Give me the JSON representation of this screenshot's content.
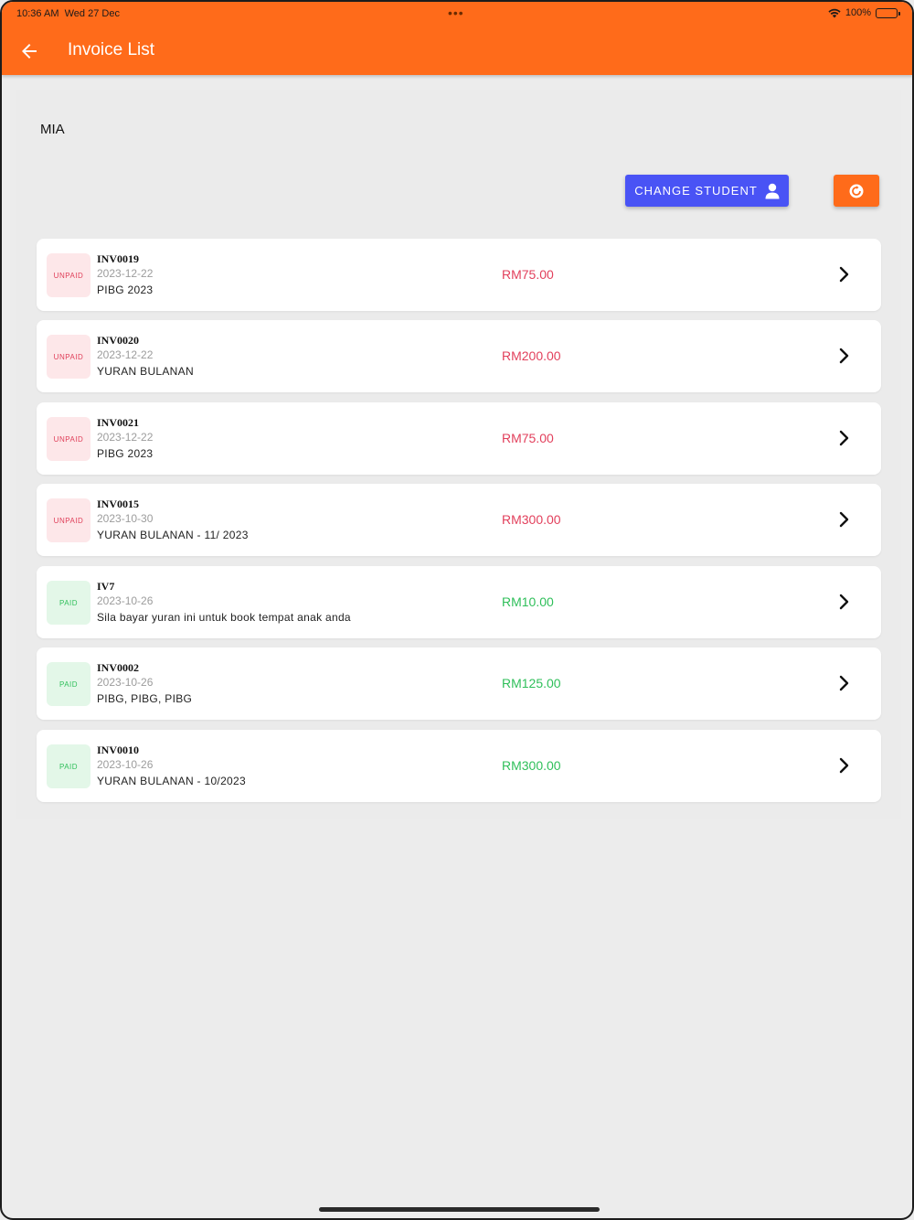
{
  "status_bar": {
    "time": "10:36 AM",
    "date": "Wed 27 Dec",
    "battery": "100%"
  },
  "header": {
    "title": "Invoice List",
    "back_icon": "arrow-left-icon",
    "background": "#ff6b1a"
  },
  "student": {
    "name": "MIA"
  },
  "actions": {
    "change_student_label": "CHANGE STUDENT",
    "change_student_icon": "person-icon",
    "change_student_color": "#4953f5",
    "refresh_icon": "refresh-icon",
    "refresh_color": "#ff6b1a"
  },
  "invoices": [
    {
      "status": "UNPAID",
      "number": "INV0019",
      "date": "2023-12-22",
      "description": "PIBG 2023",
      "amount": "RM75.00"
    },
    {
      "status": "UNPAID",
      "number": "INV0020",
      "date": "2023-12-22",
      "description": "YURAN BULANAN",
      "amount": "RM200.00"
    },
    {
      "status": "UNPAID",
      "number": "INV0021",
      "date": "2023-12-22",
      "description": "PIBG 2023",
      "amount": "RM75.00"
    },
    {
      "status": "UNPAID",
      "number": "INV0015",
      "date": "2023-10-30",
      "description": "YURAN BULANAN - 11/ 2023",
      "amount": "RM300.00"
    },
    {
      "status": "PAID",
      "number": "IV7",
      "date": "2023-10-26",
      "description": "Sila bayar yuran ini untuk book tempat anak anda",
      "amount": "RM10.00"
    },
    {
      "status": "PAID",
      "number": "INV0002",
      "date": "2023-10-26",
      "description": "PIBG, PIBG, PIBG",
      "amount": "RM125.00"
    },
    {
      "status": "PAID",
      "number": "INV0010",
      "date": "2023-10-26",
      "description": "YURAN BULANAN - 10/2023",
      "amount": "RM300.00"
    }
  ],
  "colors": {
    "unpaid": "#e2405c",
    "paid": "#2fbf5a"
  }
}
